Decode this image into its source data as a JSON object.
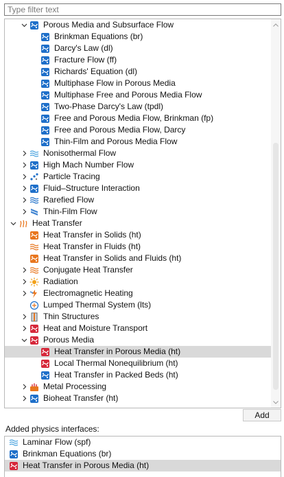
{
  "filter": {
    "placeholder": "Type filter text"
  },
  "tree_items": [
    {
      "label": "Porous Media and Subsurface Flow",
      "indent": 1,
      "expander": "open",
      "icon": "porous-media-icon",
      "color": "#1e6fc9"
    },
    {
      "label": "Brinkman Equations (br)",
      "indent": 2,
      "expander": "none",
      "icon": "brinkman-equations-icon",
      "color": "#1e6fc9"
    },
    {
      "label": "Darcy's Law (dl)",
      "indent": 2,
      "expander": "none",
      "icon": "darcys-law-icon",
      "color": "#1e6fc9"
    },
    {
      "label": "Fracture Flow (ff)",
      "indent": 2,
      "expander": "none",
      "icon": "fracture-flow-icon",
      "color": "#1e6fc9"
    },
    {
      "label": "Richards' Equation (dl)",
      "indent": 2,
      "expander": "none",
      "icon": "richards-equation-icon",
      "color": "#1e6fc9"
    },
    {
      "label": "Multiphase Flow in Porous Media",
      "indent": 2,
      "expander": "none",
      "icon": "multiphase-flow-icon",
      "color": "#1e6fc9"
    },
    {
      "label": "Multiphase Free and Porous Media Flow",
      "indent": 2,
      "expander": "none",
      "icon": "multiphase-free-porous-icon",
      "color": "#1e6fc9"
    },
    {
      "label": "Two-Phase Darcy's Law (tpdl)",
      "indent": 2,
      "expander": "none",
      "icon": "two-phase-darcy-icon",
      "color": "#1e6fc9"
    },
    {
      "label": "Free and Porous Media Flow, Brinkman (fp)",
      "indent": 2,
      "expander": "none",
      "icon": "free-porous-brinkman-icon",
      "color": "#1e6fc9"
    },
    {
      "label": "Free and Porous Media Flow, Darcy",
      "indent": 2,
      "expander": "none",
      "icon": "free-porous-darcy-icon",
      "color": "#1e6fc9"
    },
    {
      "label": "Thin-Film and Porous Media Flow",
      "indent": 2,
      "expander": "none",
      "icon": "thin-film-porous-icon",
      "color": "#1e6fc9"
    },
    {
      "label": "Nonisothermal Flow",
      "indent": 1,
      "expander": "closed",
      "icon": "nonisothermal-flow-icon",
      "color": "#4aa3df"
    },
    {
      "label": "High Mach Number Flow",
      "indent": 1,
      "expander": "closed",
      "icon": "high-mach-flow-icon",
      "color": "#1e6fc9"
    },
    {
      "label": "Particle Tracing",
      "indent": 1,
      "expander": "closed",
      "icon": "particle-tracing-icon",
      "color": "#1e6fc9"
    },
    {
      "label": "Fluid–Structure Interaction",
      "indent": 1,
      "expander": "closed",
      "icon": "fluid-structure-icon",
      "color": "#1e6fc9"
    },
    {
      "label": "Rarefied Flow",
      "indent": 1,
      "expander": "closed",
      "icon": "rarefied-flow-icon",
      "color": "#1e6fc9"
    },
    {
      "label": "Thin-Film Flow",
      "indent": 1,
      "expander": "closed",
      "icon": "thin-film-flow-icon",
      "color": "#1e6fc9"
    },
    {
      "label": "Heat Transfer",
      "indent": 0,
      "expander": "open",
      "icon": "heat-transfer-icon",
      "color": "#e8761e"
    },
    {
      "label": "Heat Transfer in Solids (ht)",
      "indent": 1,
      "expander": "none",
      "icon": "heat-solids-icon",
      "color": "#e8761e"
    },
    {
      "label": "Heat Transfer in Fluids (ht)",
      "indent": 1,
      "expander": "none",
      "icon": "heat-fluids-icon",
      "color": "#e8761e"
    },
    {
      "label": "Heat Transfer in Solids and Fluids (ht)",
      "indent": 1,
      "expander": "none",
      "icon": "heat-solids-fluids-icon",
      "color": "#e8761e"
    },
    {
      "label": "Conjugate Heat Transfer",
      "indent": 1,
      "expander": "closed",
      "icon": "conjugate-heat-icon",
      "color": "#e8761e"
    },
    {
      "label": "Radiation",
      "indent": 1,
      "expander": "closed",
      "icon": "radiation-icon",
      "color": "#f2a11a"
    },
    {
      "label": "Electromagnetic Heating",
      "indent": 1,
      "expander": "closed",
      "icon": "electromagnetic-heating-icon",
      "color": "#e8761e"
    },
    {
      "label": "Lumped Thermal System (lts)",
      "indent": 1,
      "expander": "none",
      "icon": "lumped-thermal-icon",
      "color": "#1e6fc9"
    },
    {
      "label": "Thin Structures",
      "indent": 1,
      "expander": "closed",
      "icon": "thin-structures-icon",
      "color": "#e8761e"
    },
    {
      "label": "Heat and Moisture Transport",
      "indent": 1,
      "expander": "closed",
      "icon": "heat-moisture-icon",
      "color": "#d6283a"
    },
    {
      "label": "Porous Media",
      "indent": 1,
      "expander": "open",
      "icon": "porous-media-heat-icon",
      "color": "#d6283a"
    },
    {
      "label": "Heat Transfer in Porous Media (ht)",
      "indent": 2,
      "expander": "none",
      "icon": "heat-porous-media-icon",
      "color": "#d6283a",
      "selected": true
    },
    {
      "label": "Local Thermal Nonequilibrium (ht)",
      "indent": 2,
      "expander": "none",
      "icon": "local-thermal-noneq-icon",
      "color": "#d6283a"
    },
    {
      "label": "Heat Transfer in Packed Beds (ht)",
      "indent": 2,
      "expander": "none",
      "icon": "packed-beds-icon",
      "color": "#1e6fc9"
    },
    {
      "label": "Metal Processing",
      "indent": 1,
      "expander": "closed",
      "icon": "metal-processing-icon",
      "color": "#e8761e"
    },
    {
      "label": "Bioheat Transfer (ht)",
      "indent": 1,
      "expander": "closed",
      "icon": "bioheat-icon",
      "color": "#1e6fc9"
    }
  ],
  "add_button": {
    "label": "Add"
  },
  "added_section": {
    "title": "Added physics interfaces:",
    "items": [
      {
        "label": "Laminar Flow (spf)",
        "icon": "laminar-flow-icon",
        "color": "#4aa3df"
      },
      {
        "label": "Brinkman Equations (br)",
        "icon": "brinkman-equations-icon",
        "color": "#1e6fc9"
      },
      {
        "label": "Heat Transfer in Porous Media (ht)",
        "icon": "heat-porous-media-icon",
        "color": "#d6283a",
        "selected": true
      }
    ]
  }
}
